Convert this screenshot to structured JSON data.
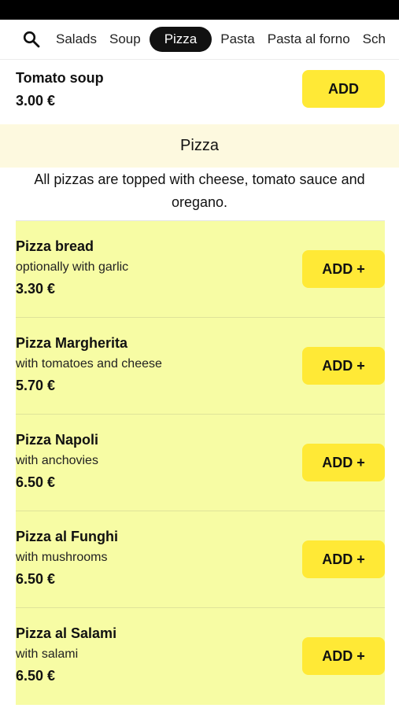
{
  "nav": {
    "categories": [
      "Salads",
      "Soup",
      "Pizza",
      "Pasta",
      "Pasta al forno",
      "Sch"
    ],
    "active": "Pizza"
  },
  "previous_item": {
    "name": "Tomato soup",
    "price": "3.00 €",
    "button": "ADD"
  },
  "section": {
    "title": "Pizza",
    "note": "All pizzas are topped with cheese, tomato sauce and oregano."
  },
  "items": [
    {
      "name": "Pizza bread",
      "desc": "optionally with garlic",
      "price": "3.30 €",
      "button": "ADD +"
    },
    {
      "name": "Pizza Margherita",
      "desc": "with tomatoes and cheese",
      "price": "5.70 €",
      "button": "ADD +"
    },
    {
      "name": "Pizza Napoli",
      "desc": "with anchovies",
      "price": "6.50 €",
      "button": "ADD +"
    },
    {
      "name": "Pizza al Funghi",
      "desc": "with mushrooms",
      "price": "6.50 €",
      "button": "ADD +"
    },
    {
      "name": "Pizza al Salami",
      "desc": "with salami",
      "price": "6.50 €",
      "button": "ADD +"
    }
  ],
  "colors": {
    "accent_button": "#ffe936",
    "item_background": "#f7fca4",
    "section_band": "#fdf9df",
    "active_tab": "#111111"
  },
  "icons": {
    "search": "search-icon"
  }
}
